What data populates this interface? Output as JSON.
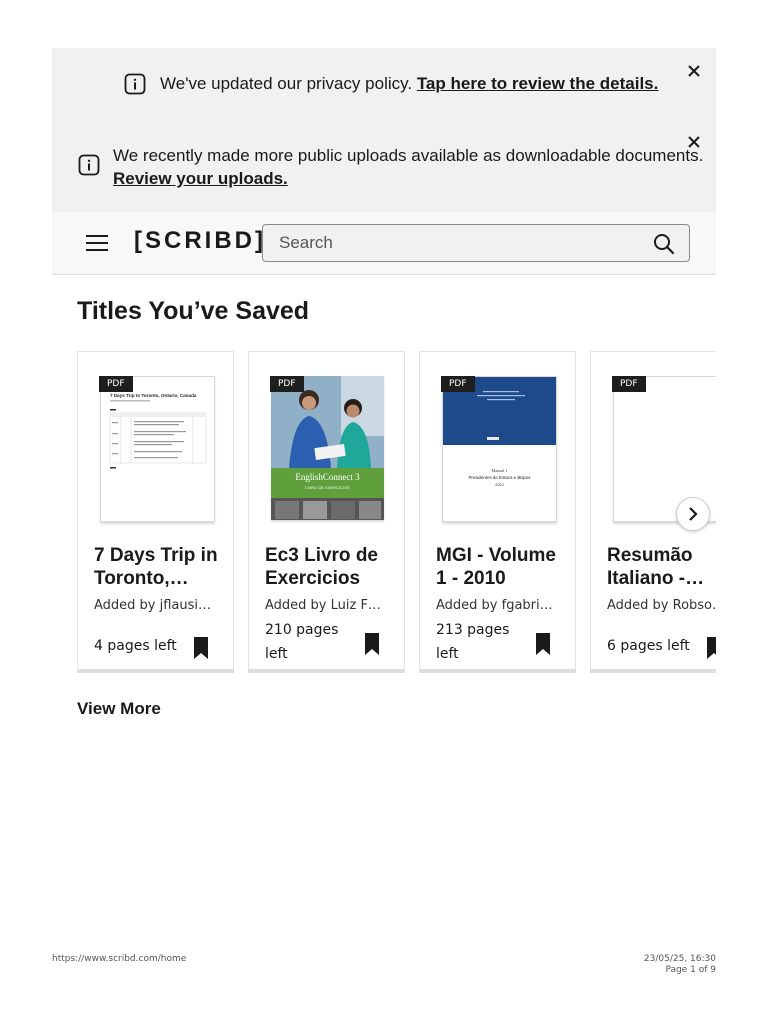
{
  "banners": {
    "privacy": {
      "text": "We've updated our privacy policy. ",
      "link": "Tap here to review the details."
    },
    "uploads": {
      "text": "We recently made more public uploads available as downloadable documents.",
      "link": "Review your uploads."
    }
  },
  "header": {
    "logo": "[SCRIBD]",
    "search_placeholder": "Search"
  },
  "section": {
    "title": "Titles You’ve Saved",
    "view_more": "View More"
  },
  "cards": [
    {
      "badge": "PDF",
      "title": "7 Days Trip in Toronto,…",
      "author": "Added by jflausi…",
      "pages": "4 pages left",
      "thumb_heading": "7 Days Trip to Toronto, Ontario, Canada"
    },
    {
      "badge": "PDF",
      "title": "Ec3 Livro de Exercicios",
      "author": "Added by Luiz F…",
      "pages": "210 pages left",
      "thumb_brand": "EnglishConnect 3",
      "thumb_sub": "LIVRO DE EXERCÍCIOS"
    },
    {
      "badge": "PDF",
      "title": "MGI - Volume 1 - 2010",
      "author": "Added by fgabrie…",
      "pages": "213 pages left",
      "thumb_line1": "Manual 1",
      "thumb_line2": "Presidentes de Estaca e Bispos",
      "thumb_line3": "2010"
    },
    {
      "badge": "PDF",
      "title": "Resumão Italiano -…",
      "author": "Added by Robso…",
      "pages": "6 pages left"
    }
  ],
  "footer": {
    "url": "https://www.scribd.com/home",
    "datetime": "23/05/25, 16:30",
    "page": "Page 1 of 9"
  },
  "colors": {
    "banner_bg": "#f1f1f1",
    "header_bg": "#f8f8f6",
    "navy_cover": "#1c4a8a",
    "green_band": "#5fa03c"
  }
}
